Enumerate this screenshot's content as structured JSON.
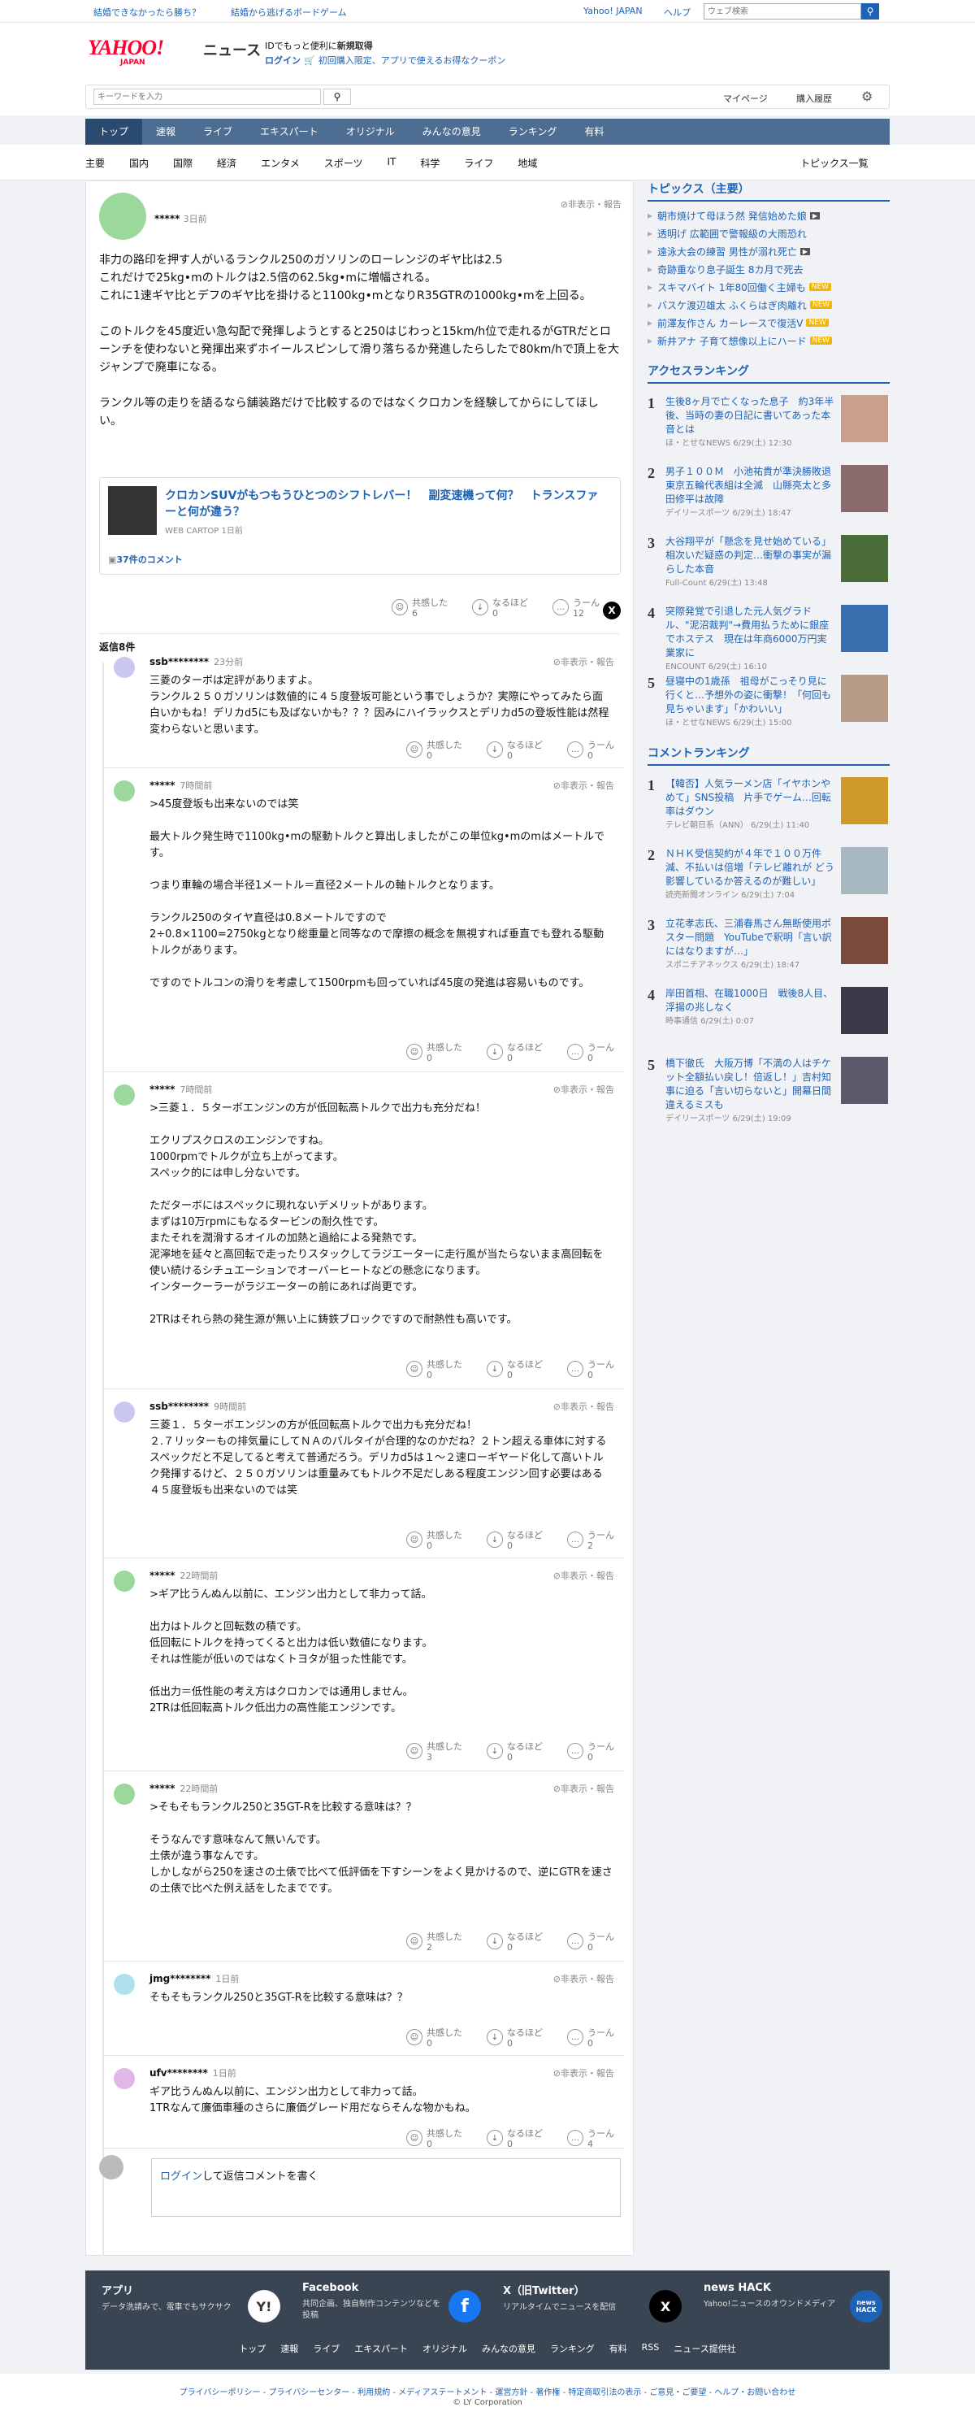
{
  "topbar": {
    "left_link1": "結婚できなかったら勝ち？",
    "left_link2": "結婚から逃げるボードゲーム",
    "right_link1": "Yahoo! JAPAN",
    "right_link2": "ヘルプ",
    "search_placeholder": "ウェブ検索"
  },
  "header": {
    "logo": "YAHOO!",
    "logo_sub": "JAPAN",
    "service": "ニュース",
    "promo_text": "IDでもっと便利に",
    "promo_link": "新規取得",
    "login": "ログイン",
    "coupon": "初回購入限定、アプリで使えるお得なクーポン"
  },
  "search": {
    "placeholder": "キーワードを入力",
    "mypage": "マイページ",
    "history": "購入履歴"
  },
  "gnav": [
    "トップ",
    "速報",
    "ライブ",
    "エキスパート",
    "オリジナル",
    "みんなの意見",
    "ランキング",
    "有料"
  ],
  "subnav": [
    "主要",
    "国内",
    "国際",
    "経済",
    "エンタメ",
    "スポーツ",
    "IT",
    "科学",
    "ライフ",
    "地域"
  ],
  "subnav_right": "トピックス一覧",
  "post": {
    "user": "*****",
    "time": "3日前",
    "hide": "非表示・報告",
    "body": "非力の路印を押す人がいるランクル250のガソリンのローレンジのギヤ比は2.5\nこれだけで25kg•mのトルクは2.5倍の62.5kg•mに増幅される。\nこれに1速ギヤ比とデフのギヤ比を掛けると1100kg•mとなりR35GTRの1000kg•mを上回る。\n\nこのトルクを45度近い急勾配で発揮しようとすると250はじわっと15km/h位で走れるがGTRだとローンチを使わないと発揮出来ずホイールスピンして滑り落ちるか発進したらしたで80km/hで頂上を大ジャンプで廃車になる。\n\nランクル等の走りを語るなら舗装路だけで比較するのではなくクロカンを経験してからにしてほしい。",
    "article_title": "クロカンSUVがもつもうひとつのシフトレバー！　副変速機って何？　トランスファーと何が違う？",
    "article_source": "WEB CARTOP",
    "article_time": "1日前",
    "comments_link": "37件のコメント",
    "reactions": [
      {
        "label": "共感した",
        "count": "6"
      },
      {
        "label": "なるほど",
        "count": "0"
      },
      {
        "label": "うーん",
        "count": "12"
      }
    ]
  },
  "replies_title": "返信8件",
  "replies": [
    {
      "user": "ssb********",
      "time": "23分前",
      "hide": "非表示・報告",
      "body": "三菱のターボは定評がありますよ。\nランクル２５０ガソリンは数値的に４５度登坂可能という事でしょうか？実際にやってみたら面白いかもね！デリカd5にも及ばないかも？？？因みにハイラックスとデリカd5の登坂性能は然程変わらないと思います。",
      "r": [
        "0",
        "0",
        "0"
      ]
    },
    {
      "user": "*****",
      "time": "7時間前",
      "hide": "非表示・報告",
      "body": ">45度登坂も出来ないのでは笑\n\n最大トルク発生時で1100kg•mの駆動トルクと算出しましたがこの単位kg•mのmはメートルです。\n\nつまり車輪の場合半径1メートル＝直径2メートルの軸トルクとなります。\n\nランクル250のタイヤ直径は0.8メートルですので\n2÷0.8×1100=2750kgとなり総重量と同等なので摩擦の概念を無視すれば垂直でも登れる駆動トルクがあります。\n\nですのでトルコンの滑りを考慮して1500rpmも回っていれば45度の発進は容易いものです。",
      "r": [
        "0",
        "0",
        "0"
      ]
    },
    {
      "user": "*****",
      "time": "7時間前",
      "hide": "非表示・報告",
      "body": ">三菱１．５ターボエンジンの方が低回転高トルクで出力も充分だね！\n\nエクリプスクロスのエンジンですね。\n1000rpmでトルクが立ち上がってます。\nスペック的には申し分ないです。\n\nただターボにはスペックに現れないデメリットがあります。\nまずは10万rpmにもなるタービンの耐久性です。\nまたそれを潤滑するオイルの加熱と過給による発熱です。\n泥濘地を延々と高回転で走ったりスタックしてラジエーターに走行風が当たらないまま高回転を使い続けるシチュエーションでオーバーヒートなどの懸念になります。\nインタークーラーがラジエーターの前にあれば尚更です。\n\n2TRはそれら熱の発生源が無い上に鋳鉄ブロックですので耐熱性も高いです。",
      "r": [
        "0",
        "0",
        "0"
      ]
    },
    {
      "user": "ssb********",
      "time": "9時間前",
      "hide": "非表示・報告",
      "body": "三菱１．５ターボエンジンの方が低回転高トルクで出力も充分だね！\n２.７リッターもの排気量にしてＮＡのパルタイが合理的なのかだね？２トン超える車体に対するスペックだと不足してると考えて普通だろう。デリカd5は１～２速ローギヤード化して高いトルク発揮するけど、２５０ガソリンは重量みてもトルク不足だしある程度エンジン回す必要はある　４５度登坂も出来ないのでは笑",
      "r": [
        "0",
        "0",
        "2"
      ]
    },
    {
      "user": "*****",
      "time": "22時間前",
      "hide": "非表示・報告",
      "body": ">ギア比うんぬん以前に、エンジン出力として非力って話。\n\n出力はトルクと回転数の積です。\n低回転にトルクを持ってくると出力は低い数値になります。\nそれは性能が低いのではなくトヨタが狙った性能です。\n\n低出力＝低性能の考え方はクロカンでは通用しません。\n2TRは低回転高トルク低出力の高性能エンジンです。",
      "r": [
        "3",
        "0",
        "0"
      ]
    },
    {
      "user": "*****",
      "time": "22時間前",
      "hide": "非表示・報告",
      "body": ">そもそもランクル250と35GT-Rを比較する意味は？？\n\nそうなんです意味なんて無いんです。\n土俵が違う事なんです。\nしかしながら250を速さの土俵で比べて低評価を下すシーンをよく見かけるので、逆にGTRを速さの土俵で比べた例え話をしたまでです。",
      "r": [
        "2",
        "0",
        "0"
      ]
    },
    {
      "user": "jmg********",
      "time": "1日前",
      "hide": "非表示・報告",
      "body": "そもそもランクル250と35GT-Rを比較する意味は？？",
      "r": [
        "0",
        "0",
        "0"
      ]
    },
    {
      "user": "ufv********",
      "time": "1日前",
      "hide": "非表示・報告",
      "body": "ギア比うんぬん以前に、エンジン出力として非力って話。\n1TRなんて廉価車種のさらに廉価グレード用だならそんな物かもね。",
      "r": [
        "0",
        "0",
        "4"
      ]
    }
  ],
  "reaction_labels": [
    "共感した",
    "なるほど",
    "うーん"
  ],
  "reply_box": {
    "login": "ログイン",
    "text": "して返信コメントを書く"
  },
  "topics": {
    "title": "トピックス（主要）",
    "items": [
      {
        "text": "朝市焼けて母ほう然 発信始めた娘",
        "badge": "vid"
      },
      {
        "text": "透明げ 広範囲で警報級の大雨恐れ",
        "badge": ""
      },
      {
        "text": "遠泳大会の練習 男性が溺れ死亡",
        "badge": "vid"
      },
      {
        "text": "奇跡重なり息子誕生 8カ月で死去",
        "badge": ""
      },
      {
        "text": "スキマバイト 1年80回働く主婦も",
        "badge": "NEW"
      },
      {
        "text": "バスケ渡辺雄太 ふくらはぎ肉離れ",
        "badge": "NEW"
      },
      {
        "text": "前澤友作さん カーレースで復活V",
        "badge": "NEW"
      },
      {
        "text": "新井アナ 子育て想像以上にハード",
        "badge": "NEW"
      }
    ]
  },
  "access": {
    "title": "アクセスランキング",
    "items": [
      {
        "n": "1",
        "text": "生後8ヶ月で亡くなった息子　約3年半後、当時の妻の日記に書いてあった本音とは",
        "src": "ほ・とせなNEWS 6/29(土) 12:30"
      },
      {
        "n": "2",
        "text": "男子１００Ｍ　小池祐貴が準決勝敗退　東京五輪代表組は全滅　山縣亮太と多田修平は故障",
        "src": "デイリースポーツ 6/29(土) 18:47"
      },
      {
        "n": "3",
        "text": "大谷翔平が「懸念を見せ始めている」　相次いだ疑惑の判定…衝撃の事実が漏らした本音",
        "src": "Full-Count 6/29(土) 13:48"
      },
      {
        "n": "4",
        "text": "突際発覚で引退した元人気グラドル、\"泥沼裁判\"→費用払うために銀座でホステス　現在は年商6000万円実業家に",
        "src": "ENCOUNT 6/29(土) 16:10"
      },
      {
        "n": "5",
        "text": "昼寝中の1歳孫　祖母がこっそり見に行くと…予想外の姿に衝撃！「何回も見ちゃいます」「かわいい」",
        "src": "ほ・とせなNEWS 6/29(土) 15:00"
      }
    ]
  },
  "comment_rank": {
    "title": "コメントランキング",
    "items": [
      {
        "n": "1",
        "text": "【韓否】人気ラーメン店「イヤホンやめて」SNS投稿　片手でゲーム…回転率はダウン",
        "src": "テレビ朝日系（ANN） 6/29(土) 11:40"
      },
      {
        "n": "2",
        "text": "ＮＨＫ受信契約が４年で１００万件減、不払いは倍増「テレビ離れが どう影響しているか答えるのが難しい」",
        "src": "読売新聞オンライン 6/29(土) 7:04"
      },
      {
        "n": "3",
        "text": "立花孝志氏、三浦春馬さん無断使用ポスター問題　YouTubeで釈明「言い訳にはなりますが…」",
        "src": "スポニチアネックス 6/29(土) 18:47"
      },
      {
        "n": "4",
        "text": "岸田首相、在職1000日　戦後8人目、浮揚の兆しなく",
        "src": "時事通信 6/29(土) 0:07"
      },
      {
        "n": "5",
        "text": "橋下徹氏　大阪万博「不満の人はチケット全額払い戻し！倍返し！」吉村知事に迫る「言い切らないと」開幕日間違えるミスも",
        "src": "デイリースポーツ 6/29(土) 19:09"
      }
    ]
  },
  "footer": {
    "apps": [
      {
        "title": "アプリ",
        "desc": "データ洗請みで、電車でもサクサク",
        "icon": "Y!"
      },
      {
        "title": "Facebook",
        "desc": "共同企画、独自制作コンテンツなどを投稿",
        "icon": "f"
      },
      {
        "title": "X（旧Twitter）",
        "desc": "リアルタイムでニュースを配信",
        "icon": "X"
      },
      {
        "title": "news HACK",
        "desc": "Yahoo!ニュースのオウンドメディア",
        "icon": "news HACK"
      }
    ],
    "nav": [
      "トップ",
      "速報",
      "ライブ",
      "エキスパート",
      "オリジナル",
      "みんなの意見",
      "ランキング",
      "有料",
      "RSS",
      "ニュース提供社"
    ],
    "links": "プライバシーポリシー - プライバシーセンター - 利用規約 - メディアステートメント - 運営方針 - 著作権 - 特定商取引法の表示 - ご意見・ご要望 - ヘルプ・お問い合わせ",
    "copyright": "© LY Corporation"
  },
  "colors": {
    "nav": "#4d6d92",
    "link": "#1e62b5",
    "new": "#f2b705"
  }
}
